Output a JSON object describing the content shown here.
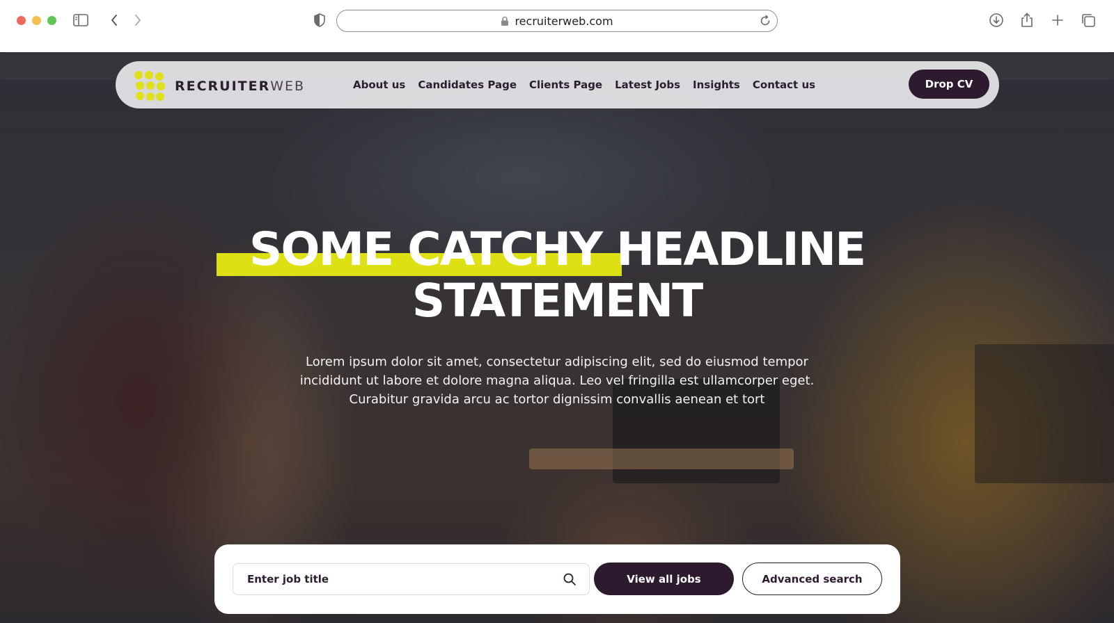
{
  "browser": {
    "url": "recruiterweb.com",
    "icons": [
      "sidebar-icon",
      "back-icon",
      "forward-icon",
      "shield-icon",
      "lock-icon",
      "reload-icon",
      "download-icon",
      "share-icon",
      "new-tab-icon",
      "tabs-overview-icon"
    ]
  },
  "brand": {
    "name_bold": "RECRUITER",
    "name_light": "WEB",
    "accent": "#dde013",
    "dark": "#2d1a2f"
  },
  "nav": {
    "links": [
      "About us",
      "Candidates Page",
      "Clients Page",
      "Latest Jobs",
      "Insights",
      "Contact us"
    ],
    "cta": "Drop CV"
  },
  "hero": {
    "headline_line1": "SOME CATCHY HEADLINE",
    "headline_line2": "STATEMENT",
    "subtext": "Lorem ipsum dolor sit amet, consectetur adipiscing elit, sed do eiusmod tempor incididunt ut labore et dolore magna aliqua. Leo vel fringilla est ullamcorper eget. Curabitur gravida arcu ac tortor dignissim convallis aenean et tort"
  },
  "search": {
    "placeholder": "Enter job title",
    "view_all_label": "View all jobs",
    "advanced_label": "Advanced search"
  }
}
